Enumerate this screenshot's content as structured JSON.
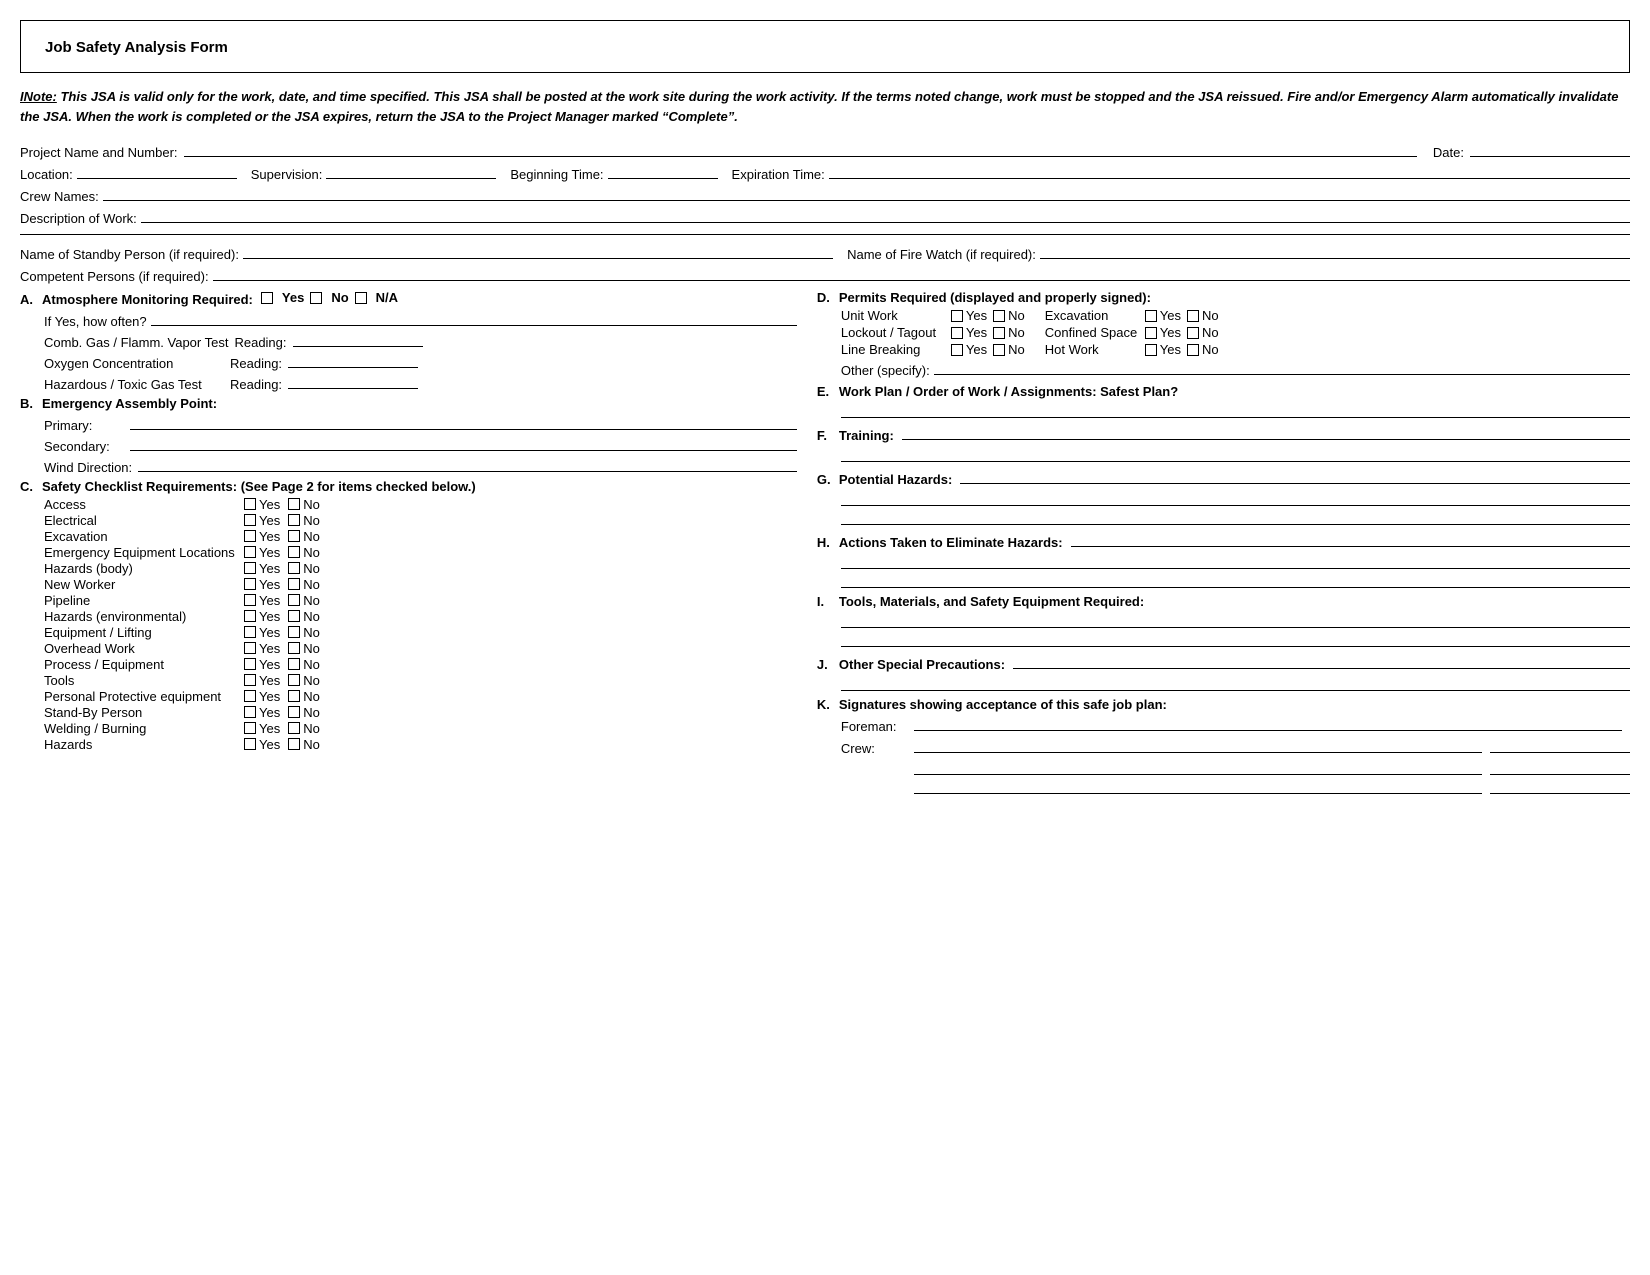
{
  "form": {
    "title": "Job Safety Analysis Form",
    "note": {
      "prefix": "INote:",
      "body": "  This JSA is valid only for the work, date, and time specified.  This JSA shall be posted at the work site during the work activity.  If the terms noted change, work must be stopped and the JSA reissued.  Fire and/or Emergency Alarm automatically invalidate the JSA.  When the work is completed or the JSA expires, return the JSA to the Project Manager marked “Complete”."
    },
    "fields": {
      "project_name_label": "Project Name and Number:",
      "date_label": "Date:",
      "location_label": "Location:",
      "supervision_label": "Supervision:",
      "beginning_time_label": "Beginning Time:",
      "expiration_time_label": "Expiration Time:",
      "crew_names_label": "Crew Names:",
      "description_label": "Description of Work:"
    },
    "standby": {
      "label": "Name of Standby Person (if required):",
      "firewatch_label": "Name of Fire Watch (if required):"
    },
    "competent": {
      "label": "Competent Persons (if required):"
    },
    "section_a": {
      "letter": "A.",
      "title": "Atmosphere Monitoring Required:",
      "yes": "Yes",
      "no": "No",
      "na": "N/A",
      "if_yes_label": "If Yes, how often?",
      "items": [
        {
          "label": "Comb. Gas / Flamm. Vapor Test",
          "reading": "Reading:"
        },
        {
          "label": "Oxygen Concentration",
          "reading": "Reading:"
        },
        {
          "label": "Hazardous / Toxic Gas Test",
          "reading": "Reading:"
        }
      ]
    },
    "section_b": {
      "letter": "B.",
      "title": "Emergency Assembly Point:",
      "items": [
        {
          "label": "Primary:"
        },
        {
          "label": "Secondary:"
        },
        {
          "label": "Wind Direction:"
        }
      ]
    },
    "section_c": {
      "letter": "C.",
      "title": "Safety Checklist Requirements:",
      "subtitle": "(See Page 2 for items checked below.)",
      "items": [
        "Access",
        "Electrical",
        "Excavation",
        "Emergency Equipment Locations",
        "Hazards (body)",
        "New Worker",
        "Pipeline",
        "Hazards (environmental)",
        "Equipment / Lifting",
        "Overhead Work",
        "Process / Equipment",
        "Tools",
        "Personal Protective equipment",
        "Stand-By Person",
        "Welding / Burning",
        "Hazards"
      ],
      "yes": "Yes",
      "no": "No"
    },
    "section_d": {
      "letter": "D.",
      "title": "Permits Required (displayed and properly signed):",
      "items": [
        {
          "label": "Unit Work",
          "excavation_label": "Excavation"
        },
        {
          "label": "Lockout / Tagout",
          "confined_label": "Confined Space"
        },
        {
          "label": "Line Breaking",
          "hot_work_label": "Hot Work"
        }
      ],
      "other_label": "Other (specify):",
      "yes": "Yes",
      "no": "No"
    },
    "section_e": {
      "letter": "E.",
      "title": "Work Plan / Order of Work / Assignments:  Safest Plan?"
    },
    "section_f": {
      "letter": "F.",
      "title": "Training:"
    },
    "section_g": {
      "letter": "G.",
      "title": "Potential Hazards:"
    },
    "section_h": {
      "letter": "H.",
      "title": "Actions Taken to Eliminate Hazards:"
    },
    "section_i": {
      "letter": "I.",
      "title": "Tools, Materials, and Safety Equipment Required:"
    },
    "section_j": {
      "letter": "J.",
      "title": "Other Special Precautions:"
    },
    "section_k": {
      "letter": "K.",
      "title": "Signatures showing acceptance of this safe job plan:",
      "foreman_label": "Foreman:",
      "crew_label": "Crew:"
    }
  }
}
